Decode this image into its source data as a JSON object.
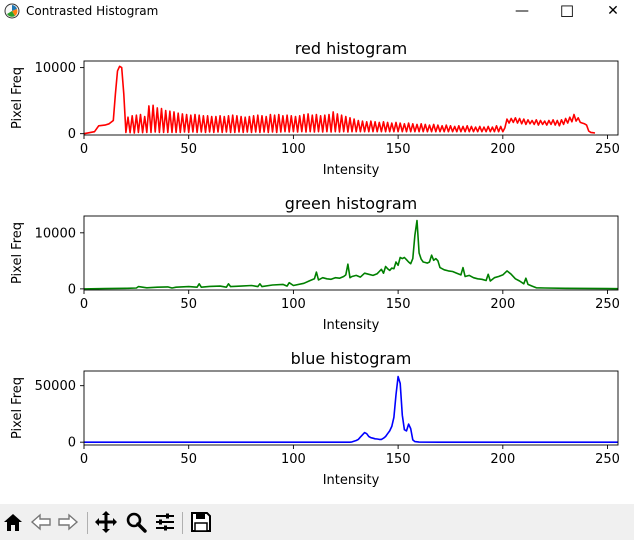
{
  "window": {
    "title": "Contrasted Histogram",
    "minimize": "—",
    "maximize": "☐",
    "close": "✕"
  },
  "toolbar": {
    "icons": [
      "home-icon",
      "back-arrow-icon",
      "forward-arrow-icon",
      "pan-icon",
      "zoom-icon",
      "configure-subplots-icon",
      "save-icon"
    ]
  },
  "chart_data": [
    {
      "type": "line",
      "title": "red histogram",
      "xlabel": "Intensity",
      "ylabel": "Pixel Freq",
      "xlim": [
        0,
        255
      ],
      "ylim": [
        -200,
        11000
      ],
      "xticks": [
        0,
        50,
        100,
        150,
        200,
        250
      ],
      "yticks": [
        0,
        10000
      ],
      "color": "#ff0000",
      "x": [
        0,
        5,
        7,
        10,
        12,
        14,
        15,
        16,
        17,
        18,
        19,
        20,
        21,
        22,
        23,
        24,
        25,
        26,
        27,
        28,
        29,
        30,
        31,
        32,
        33,
        34,
        35,
        36,
        37,
        38,
        39,
        40,
        41,
        42,
        43,
        44,
        45,
        46,
        47,
        48,
        49,
        50,
        51,
        52,
        53,
        54,
        55,
        56,
        57,
        58,
        59,
        60,
        61,
        62,
        63,
        64,
        65,
        66,
        67,
        68,
        69,
        70,
        71,
        72,
        73,
        74,
        75,
        76,
        77,
        78,
        79,
        80,
        81,
        82,
        83,
        84,
        85,
        86,
        87,
        88,
        89,
        90,
        91,
        92,
        93,
        94,
        95,
        96,
        97,
        98,
        99,
        100,
        101,
        102,
        103,
        104,
        105,
        106,
        107,
        108,
        109,
        110,
        111,
        112,
        113,
        114,
        115,
        116,
        117,
        118,
        119,
        120,
        121,
        122,
        123,
        124,
        125,
        126,
        127,
        128,
        129,
        130,
        131,
        132,
        133,
        134,
        135,
        136,
        137,
        138,
        139,
        140,
        141,
        142,
        143,
        144,
        145,
        146,
        147,
        148,
        149,
        150,
        151,
        152,
        153,
        154,
        155,
        156,
        157,
        158,
        159,
        160,
        161,
        162,
        163,
        164,
        165,
        166,
        167,
        168,
        169,
        170,
        171,
        172,
        173,
        174,
        175,
        176,
        177,
        178,
        179,
        180,
        181,
        182,
        183,
        184,
        185,
        186,
        187,
        188,
        189,
        190,
        191,
        192,
        193,
        194,
        195,
        196,
        197,
        198,
        199,
        200,
        201,
        202,
        203,
        204,
        205,
        206,
        207,
        208,
        209,
        210,
        211,
        212,
        213,
        214,
        215,
        216,
        217,
        218,
        219,
        220,
        221,
        222,
        223,
        224,
        225,
        226,
        227,
        228,
        229,
        230,
        231,
        232,
        233,
        234,
        235,
        236,
        237,
        238,
        239,
        240,
        241,
        242,
        243,
        244,
        245,
        246,
        247,
        248,
        249,
        250,
        251,
        252,
        253,
        254,
        255
      ],
      "y": [
        0,
        300,
        1200,
        1300,
        1500,
        2000,
        6000,
        9500,
        10200,
        10000,
        6000,
        200,
        2500,
        150,
        2700,
        100,
        2800,
        200,
        2900,
        150,
        2600,
        200,
        4200,
        200,
        4300,
        250,
        3900,
        200,
        3800,
        200,
        3500,
        200,
        3400,
        200,
        3300,
        200,
        3100,
        200,
        3000,
        250,
        2900,
        200,
        2800,
        250,
        2900,
        200,
        2800,
        250,
        2700,
        200,
        2700,
        250,
        2600,
        200,
        2600,
        250,
        2700,
        200,
        2600,
        250,
        2700,
        200,
        2800,
        200,
        2700,
        250,
        2600,
        200,
        2500,
        250,
        2600,
        200,
        2700,
        250,
        2800,
        200,
        2700,
        250,
        2600,
        200,
        2900,
        250,
        2800,
        200,
        2900,
        250,
        2700,
        300,
        2800,
        250,
        2700,
        300,
        2600,
        250,
        2700,
        300,
        2900,
        250,
        3000,
        300,
        2800,
        250,
        2900,
        300,
        2700,
        250,
        2800,
        300,
        2900,
        250,
        3300,
        300,
        3000,
        250,
        2800,
        300,
        2600,
        250,
        2400,
        300,
        2200,
        300,
        2000,
        300,
        1900,
        300,
        1800,
        300,
        1900,
        300,
        1800,
        300,
        1700,
        300,
        1800,
        300,
        1700,
        300,
        1600,
        300,
        1700,
        300,
        1600,
        300,
        1500,
        300,
        1600,
        300,
        1500,
        300,
        1400,
        300,
        1500,
        300,
        1400,
        300,
        1300,
        300,
        1400,
        300,
        1300,
        300,
        1200,
        300,
        1300,
        300,
        1200,
        300,
        1100,
        300,
        1200,
        300,
        1100,
        300,
        1200,
        300,
        1100,
        300,
        1000,
        300,
        1100,
        300,
        1000,
        300,
        1100,
        300,
        1000,
        300,
        1200,
        300,
        1100,
        300,
        900,
        2200,
        1600,
        2300,
        1700,
        2400,
        1600,
        2300,
        1500,
        2200,
        1400,
        2100,
        1500,
        2000,
        1400,
        2100,
        1300,
        2000,
        1400,
        1900,
        1300,
        2000,
        1400,
        2100,
        1300,
        2000,
        1200,
        2100,
        1400,
        2300,
        1600,
        2500,
        1800,
        2900,
        1900,
        2400,
        1700,
        1600,
        1500,
        1300,
        400,
        200,
        150,
        100
      ]
    },
    {
      "type": "line",
      "title": "green histogram",
      "xlabel": "Intensity",
      "ylabel": "Pixel Freq",
      "xlim": [
        0,
        255
      ],
      "ylim": [
        -200,
        13000
      ],
      "xticks": [
        0,
        50,
        100,
        150,
        200,
        250
      ],
      "yticks": [
        0,
        10000
      ],
      "color": "#008000",
      "x": [
        0,
        10,
        20,
        25,
        26,
        30,
        35,
        40,
        42,
        44,
        50,
        54,
        55,
        56,
        60,
        65,
        68,
        69,
        70,
        75,
        80,
        83,
        84,
        85,
        90,
        95,
        97,
        98,
        100,
        105,
        108,
        110,
        111,
        112,
        114,
        116,
        118,
        120,
        122,
        124,
        125,
        126,
        127,
        128,
        130,
        132,
        134,
        136,
        138,
        140,
        141,
        142,
        143,
        144,
        145,
        146,
        147,
        148,
        149,
        150,
        151,
        152,
        153,
        154,
        155,
        156,
        157,
        158,
        159,
        160,
        161,
        162,
        163,
        164,
        165,
        166,
        167,
        168,
        169,
        170,
        172,
        174,
        176,
        178,
        180,
        181,
        182,
        184,
        186,
        188,
        190,
        192,
        193,
        194,
        196,
        198,
        200,
        202,
        204,
        206,
        208,
        210,
        211,
        212,
        214,
        216,
        220,
        230,
        240,
        250,
        255
      ],
      "y": [
        0,
        50,
        100,
        150,
        400,
        200,
        300,
        350,
        150,
        300,
        400,
        300,
        900,
        300,
        450,
        500,
        300,
        900,
        400,
        500,
        600,
        400,
        900,
        400,
        700,
        800,
        500,
        1100,
        600,
        1000,
        1500,
        1800,
        3000,
        1600,
        2000,
        1800,
        1700,
        2000,
        1900,
        2200,
        2500,
        4400,
        2000,
        2200,
        2400,
        2100,
        2800,
        2600,
        2400,
        2700,
        3100,
        3500,
        2800,
        4000,
        3600,
        3300,
        3700,
        3600,
        4800,
        4200,
        5600,
        5400,
        5600,
        5200,
        4800,
        4500,
        5400,
        9600,
        12200,
        6400,
        5300,
        4800,
        4700,
        4600,
        4800,
        6000,
        5100,
        5400,
        5000,
        3800,
        3400,
        3200,
        3100,
        2800,
        2500,
        3800,
        2200,
        2400,
        2000,
        1800,
        1700,
        1500,
        2600,
        1400,
        2000,
        2200,
        2500,
        3200,
        2600,
        1800,
        1400,
        900,
        1900,
        800,
        500,
        200,
        150,
        100,
        80,
        50,
        30
      ],
      "smooth": true
    },
    {
      "type": "line",
      "title": "blue histogram",
      "xlabel": "Intensity",
      "ylabel": "Pixel Freq",
      "xlim": [
        0,
        255
      ],
      "ylim": [
        -2500,
        63000
      ],
      "xticks": [
        0,
        50,
        100,
        150,
        200,
        250
      ],
      "yticks": [
        0,
        50000
      ],
      "color": "#0000ff",
      "x": [
        0,
        50,
        100,
        120,
        127,
        128,
        130,
        131,
        132,
        133,
        134,
        135,
        136,
        137,
        138,
        139,
        140,
        141,
        142,
        143,
        144,
        145,
        146,
        147,
        148,
        149,
        150,
        151,
        152,
        153,
        154,
        155,
        156,
        157,
        158,
        160,
        170,
        200,
        255
      ],
      "y": [
        0,
        0,
        0,
        0,
        0,
        200,
        1500,
        2500,
        4500,
        6500,
        8500,
        7500,
        5000,
        4000,
        3500,
        3000,
        2800,
        2500,
        2500,
        3500,
        5000,
        7500,
        10000,
        14000,
        22000,
        42000,
        58000,
        52000,
        24000,
        11000,
        10000,
        16000,
        12000,
        2000,
        500,
        100,
        0,
        0,
        0
      ]
    }
  ]
}
